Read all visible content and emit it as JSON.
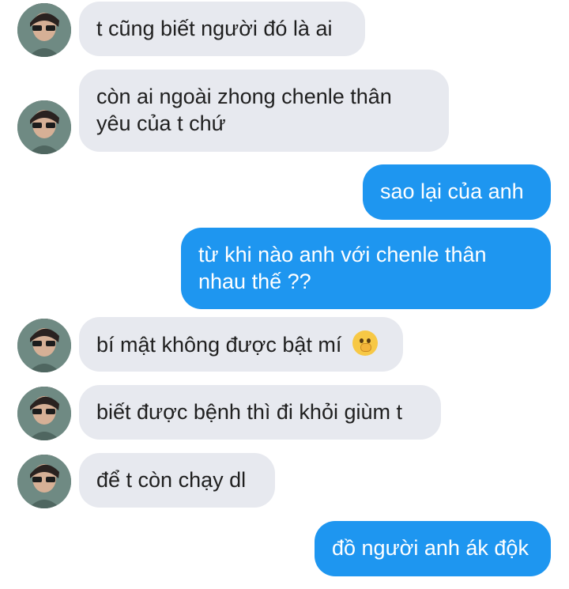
{
  "messages": [
    {
      "sender": "other",
      "text": "t cũng biết người đó là ai"
    },
    {
      "sender": "other",
      "text": "còn ai ngoài zhong chenle thân yêu của t chứ"
    },
    {
      "sender": "me",
      "text": "sao lại của anh"
    },
    {
      "sender": "me",
      "text": "từ khi nào anh với chenle thân nhau thế ??"
    },
    {
      "sender": "other",
      "text": "bí mật không được bật mí",
      "emoji": "shushing-face"
    },
    {
      "sender": "other",
      "text": "biết được bệnh thì đi khỏi giùm t"
    },
    {
      "sender": "other",
      "text": "để t còn chạy dl"
    },
    {
      "sender": "me",
      "text": "đồ người anh ák độk"
    }
  ],
  "colors": {
    "incoming": "#e7e9ef",
    "outgoing": "#1e96f0",
    "background": "#ffffff"
  }
}
